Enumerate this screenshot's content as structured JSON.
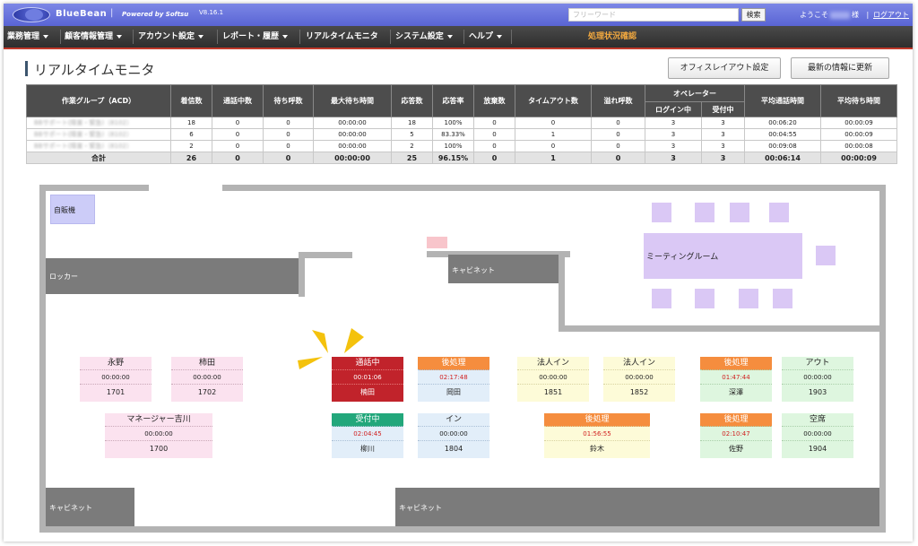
{
  "header": {
    "brand": "BlueBean",
    "sep": "|",
    "powered": "Powered by Softsu",
    "version": "V8.16.1",
    "search_placeholder": "フリーワード",
    "search_button": "検索",
    "welcome": "ようこそ",
    "welcome_suffix": "様",
    "divider": "|",
    "logout": "ログアウト"
  },
  "menu": {
    "items": [
      "業務管理",
      "顧客情報管理",
      "アカウント設定",
      "レポート・履歴",
      "リアルタイムモニタ",
      "システム設定",
      "ヘルプ"
    ],
    "status": "処理状況確認"
  },
  "page": {
    "title": "リアルタイムモニタ",
    "layout_button": "オフィスレイアウト設定",
    "refresh_button": "最新の情報に更新"
  },
  "table": {
    "headers": {
      "group": "作業グループ（ACD）",
      "incoming": "着信数",
      "talking": "通話中数",
      "waiting": "待ち呼数",
      "max_wait": "最大待ち時間",
      "answered": "応答数",
      "answer_rate": "応答率",
      "abandoned": "放棄数",
      "timeout": "タイムアウト数",
      "overflow": "溢れ呼数",
      "operator": "オペレーター",
      "login": "ログイン中",
      "accepting": "受付中",
      "avg_talk": "平均通話時間",
      "avg_wait": "平均待ち時間"
    },
    "rows": [
      {
        "group": "BBサポート(障害・緊急)（8102）",
        "incoming": "18",
        "talking": "0",
        "waiting": "0",
        "max_wait": "00:00:00",
        "answered": "18",
        "answer_rate": "100%",
        "abandoned": "0",
        "timeout": "0",
        "overflow": "0",
        "login": "3",
        "accepting": "3",
        "avg_talk": "00:06:20",
        "avg_wait": "00:00:09"
      },
      {
        "group": "BBサポート(障害・緊急)（8102）",
        "incoming": "6",
        "talking": "0",
        "waiting": "0",
        "max_wait": "00:00:00",
        "answered": "5",
        "answer_rate": "83.33%",
        "abandoned": "0",
        "timeout": "1",
        "overflow": "0",
        "login": "3",
        "accepting": "3",
        "avg_talk": "00:04:55",
        "avg_wait": "00:00:09"
      },
      {
        "group": "BBサポート(障害・緊急)（8102）",
        "incoming": "2",
        "talking": "0",
        "waiting": "0",
        "max_wait": "00:00:00",
        "answered": "2",
        "answer_rate": "100%",
        "abandoned": "0",
        "timeout": "0",
        "overflow": "0",
        "login": "3",
        "accepting": "3",
        "avg_talk": "00:09:08",
        "avg_wait": "00:00:08"
      }
    ],
    "total": {
      "group": "合計",
      "incoming": "26",
      "talking": "0",
      "waiting": "0",
      "max_wait": "00:00:00",
      "answered": "25",
      "answer_rate": "96.15%",
      "abandoned": "0",
      "timeout": "1",
      "overflow": "0",
      "login": "3",
      "accepting": "3",
      "avg_talk": "00:06:14",
      "avg_wait": "00:00:09"
    }
  },
  "floor": {
    "vending": "自販機",
    "locker": "ロッカー",
    "cabinet": "キャビネット",
    "meeting": "ミーティングルーム",
    "seats": {
      "nagano": {
        "status": "永野",
        "time": "00:00:00",
        "ext": "1701"
      },
      "kakita": {
        "status": "柿田",
        "time": "00:00:00",
        "ext": "1702"
      },
      "manager": {
        "status": "マネージャー吉川",
        "time": "00:00:00",
        "ext": "1700"
      },
      "talking": {
        "status": "通話中",
        "time": "00:01:06",
        "name": "楠田"
      },
      "okada": {
        "status": "後処理",
        "time": "02:17:48",
        "name": "岡田"
      },
      "yanagawa": {
        "status": "受付中",
        "time": "02:04:45",
        "name": "柳川"
      },
      "in1804": {
        "status": "イン",
        "time": "00:00:00",
        "ext": "1804"
      },
      "corp1851": {
        "status": "法人イン",
        "time": "00:00:00",
        "ext": "1851"
      },
      "corp1852": {
        "status": "法人イン",
        "time": "00:00:00",
        "ext": "1852"
      },
      "suzuki": {
        "status": "後処理",
        "time": "01:56:55",
        "name": "鈴木"
      },
      "fukasawa": {
        "status": "後処理",
        "time": "01:47:44",
        "name": "深澤"
      },
      "out1903": {
        "status": "アウト",
        "time": "00:00:00",
        "ext": "1903"
      },
      "sano": {
        "status": "後処理",
        "time": "02:10:47",
        "name": "佐野"
      },
      "empty1904": {
        "status": "空席",
        "time": "00:00:00",
        "ext": "1904"
      }
    }
  }
}
